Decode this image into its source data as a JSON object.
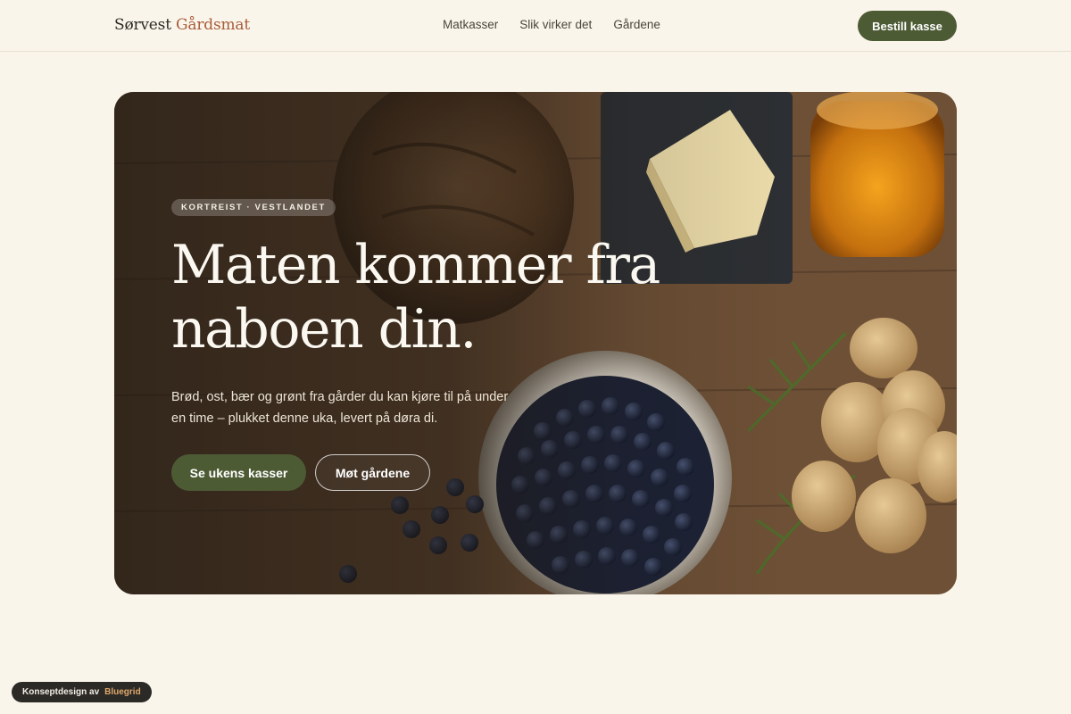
{
  "header": {
    "brand_primary": "Sørvest",
    "brand_accent": "Gårdsmat",
    "nav": [
      {
        "label": "Matkasser"
      },
      {
        "label": "Slik virker det"
      },
      {
        "label": "Gårdene"
      }
    ],
    "cta_label": "Bestill kasse"
  },
  "hero": {
    "eyebrow": "KORTREIST · VESTLANDET",
    "headline_line1": "Maten kommer fra",
    "headline_line2": "naboen din.",
    "lede": "Brød, ost, bær og grønt fra gårder du kan kjøre til på under en time – plukket denne uka, levert på døra di.",
    "primary_button": "Se ukens kasser",
    "secondary_button": "Møt gårdene",
    "image_icon": "farm-produce-photo"
  },
  "credit": {
    "prefix": "Konseptdesign av",
    "studio": "Bluegrid"
  },
  "colors": {
    "background": "#faf5ea",
    "accent_green": "#4d5b35",
    "brand_accent": "#a85c3c",
    "credit_highlight": "#e0a76b"
  }
}
